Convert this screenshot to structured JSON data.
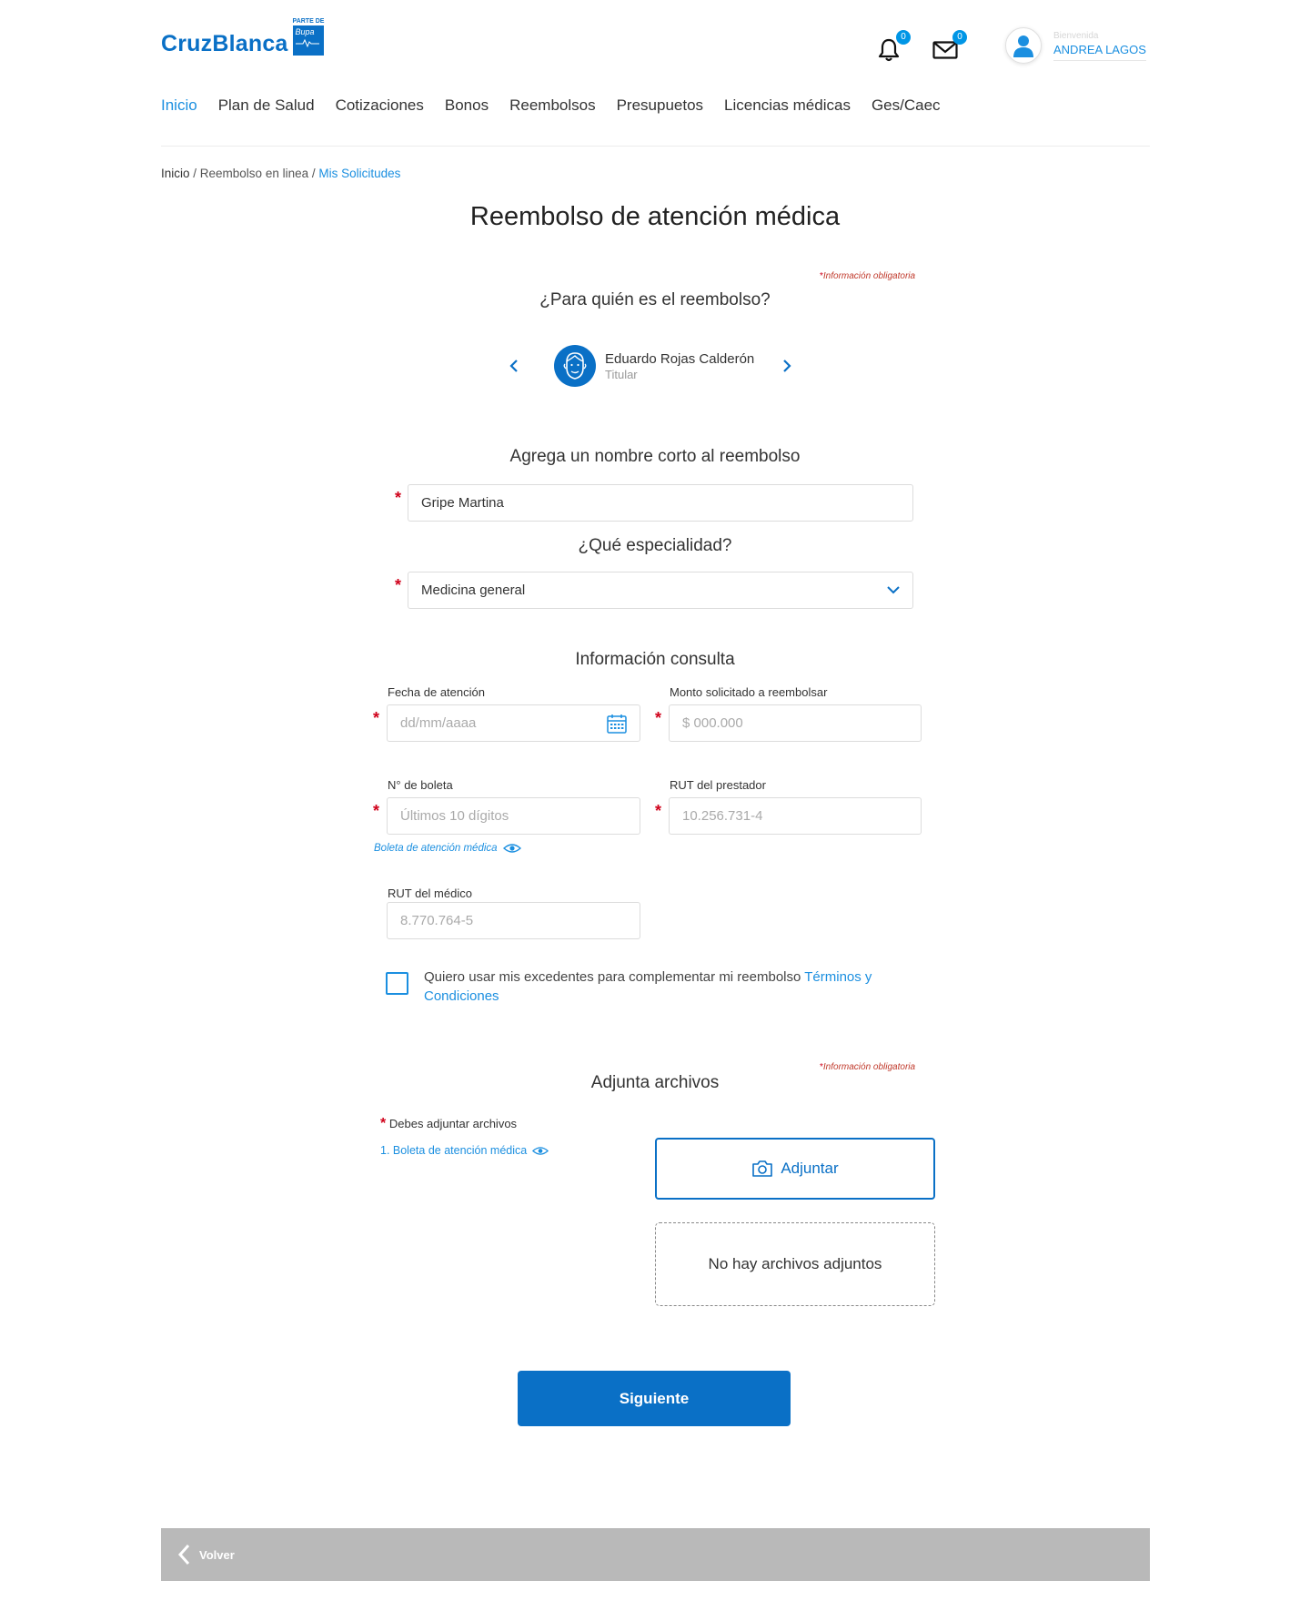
{
  "header": {
    "logo_text": "CruzBlanca",
    "partner_top": "PARTE DE",
    "partner_name": "Bupa",
    "notifications_count": "0",
    "messages_count": "0",
    "welcome": "Bienvenida",
    "user_name": "ANDREA LAGOS"
  },
  "nav": {
    "items": [
      "Inicio",
      "Plan de Salud",
      "Cotizaciones",
      "Bonos",
      "Reembolsos",
      "Presupuetos",
      "Licencias médicas",
      "Ges/Caec"
    ],
    "active_index": 0
  },
  "breadcrumb": {
    "home": "Inicio",
    "middle": "Reembolso en linea",
    "current": "Mis Solicitudes",
    "separator": " / "
  },
  "page": {
    "title": "Reembolso de atención médica",
    "required_note": "Información obligatoria",
    "required_star": "*"
  },
  "beneficiary": {
    "question": "¿Para quién es el reembolso?",
    "name": "Eduardo Rojas Calderón",
    "role": "Titular"
  },
  "short_name": {
    "title": "Agrega un nombre corto al reembolso",
    "value": "Gripe Martina"
  },
  "specialty": {
    "title": "¿Qué especialidad?",
    "selected": "Medicina general"
  },
  "consult": {
    "title": "Información consulta",
    "date_label": "Fecha de atención",
    "date_placeholder": "dd/mm/aaaa",
    "amount_label": "Monto solicitado a reembolsar",
    "amount_placeholder": "$ 000.000",
    "receipt_label": "N° de boleta",
    "receipt_placeholder": "Últimos 10 dígitos",
    "provider_rut_label": "RUT del prestador",
    "provider_rut_placeholder": "10.256.731-4",
    "receipt_link": "Boleta de atención médica",
    "doctor_rut_label": "RUT del médico",
    "doctor_rut_placeholder": "8.770.764-5"
  },
  "surplus": {
    "text": "Quiero usar mis excedentes para complementar mi reembolso ",
    "link_line1": "Términos y",
    "link_line2": "Condiciones"
  },
  "attachments": {
    "title": "Adjunta archivos",
    "must_attach": "Debes adjuntar archivos",
    "doc_link": "1. Boleta de atención médica",
    "attach_button": "Adjuntar",
    "empty_text": "No hay archivos adjuntos"
  },
  "actions": {
    "next": "Siguiente",
    "back": "Volver"
  },
  "colors": {
    "primary": "#0a70c6",
    "link": "#1b8fe0",
    "required": "#d0021b",
    "footer": "#b9b9b9"
  }
}
